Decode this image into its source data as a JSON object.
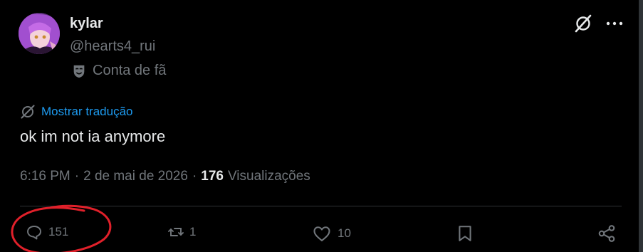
{
  "author": {
    "name": "kylar",
    "handle": "@hearts4_rui",
    "badge_label": "Conta de fã",
    "badge_icon": "theater-mask-icon",
    "avatar_icon": "avatar-image"
  },
  "header_actions": {
    "grok_icon": "grok-icon",
    "more_icon": "more-horizontal-icon"
  },
  "tweet": {
    "translate_label": "Mostrar tradução",
    "text": "ok im not ia anymore",
    "time": "6:16 PM",
    "date": "2 de mai de 2026",
    "views_count": "176",
    "views_label": "Visualizações"
  },
  "actions": {
    "reply_count": "151",
    "retweet_count": "1",
    "like_count": "10"
  },
  "colors": {
    "background": "#000000",
    "text_primary": "#e7e9ea",
    "text_secondary": "#71767b",
    "accent_blue": "#1d9bf0",
    "annotation_red": "#e0202a"
  }
}
